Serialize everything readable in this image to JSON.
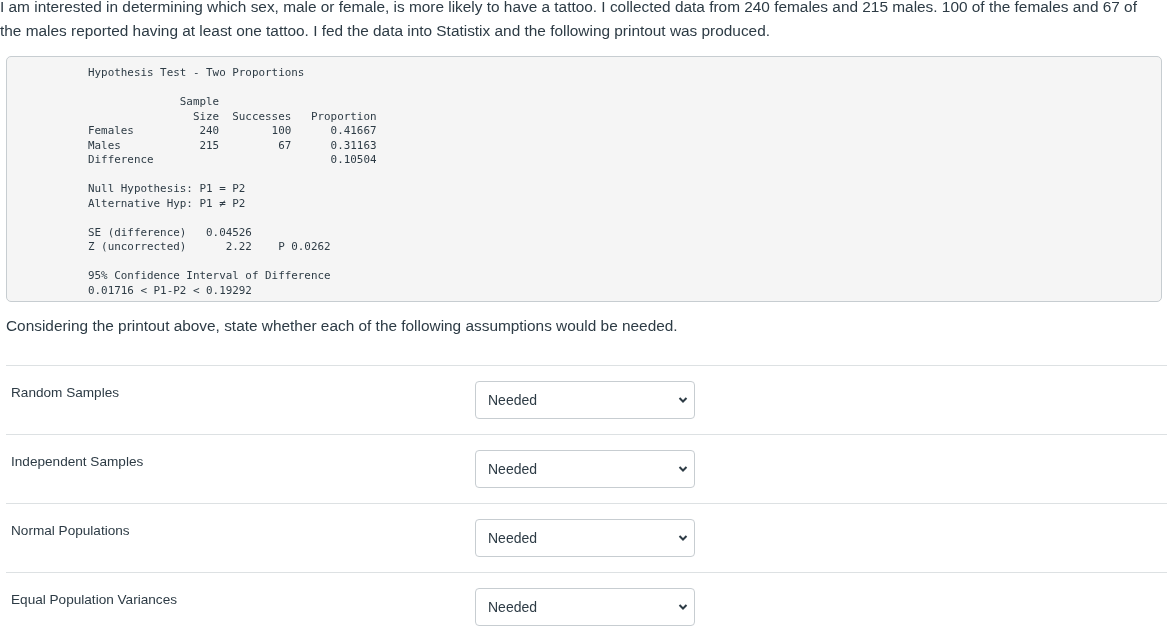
{
  "intro": "I am interested in determining which sex, male or female, is more likely to have a tattoo. I collected data from 240 females and 215 males. 100 of the females and 67 of the males reported having at least one tattoo. I fed the data into Statistix and the following printout was produced.",
  "printout": [
    [
      "Hypothesis Test - Two Proportions"
    ],
    [
      "              Sample",
      "                Size  Successes   Proportion",
      "Females          240        100      0.41667",
      "Males            215         67      0.31163",
      "Difference                           0.10504"
    ],
    [
      "Null Hypothesis: P1 = P2",
      "Alternative Hyp: P1 ≠ P2"
    ],
    [
      "SE (difference)   0.04526",
      "Z (uncorrected)      2.22    P 0.0262"
    ],
    [
      "95% Confidence Interval of Difference",
      "0.01716 < P1-P2 < 0.19292"
    ]
  ],
  "prompt": "Considering the printout above, state whether each of the following assumptions would be needed.",
  "assumptions": [
    {
      "label": "Random Samples",
      "answer": "Needed"
    },
    {
      "label": "Independent Samples",
      "answer": "Needed"
    },
    {
      "label": "Normal Populations",
      "answer": "Needed"
    },
    {
      "label": "Equal Population Variances",
      "answer": "Needed"
    }
  ]
}
